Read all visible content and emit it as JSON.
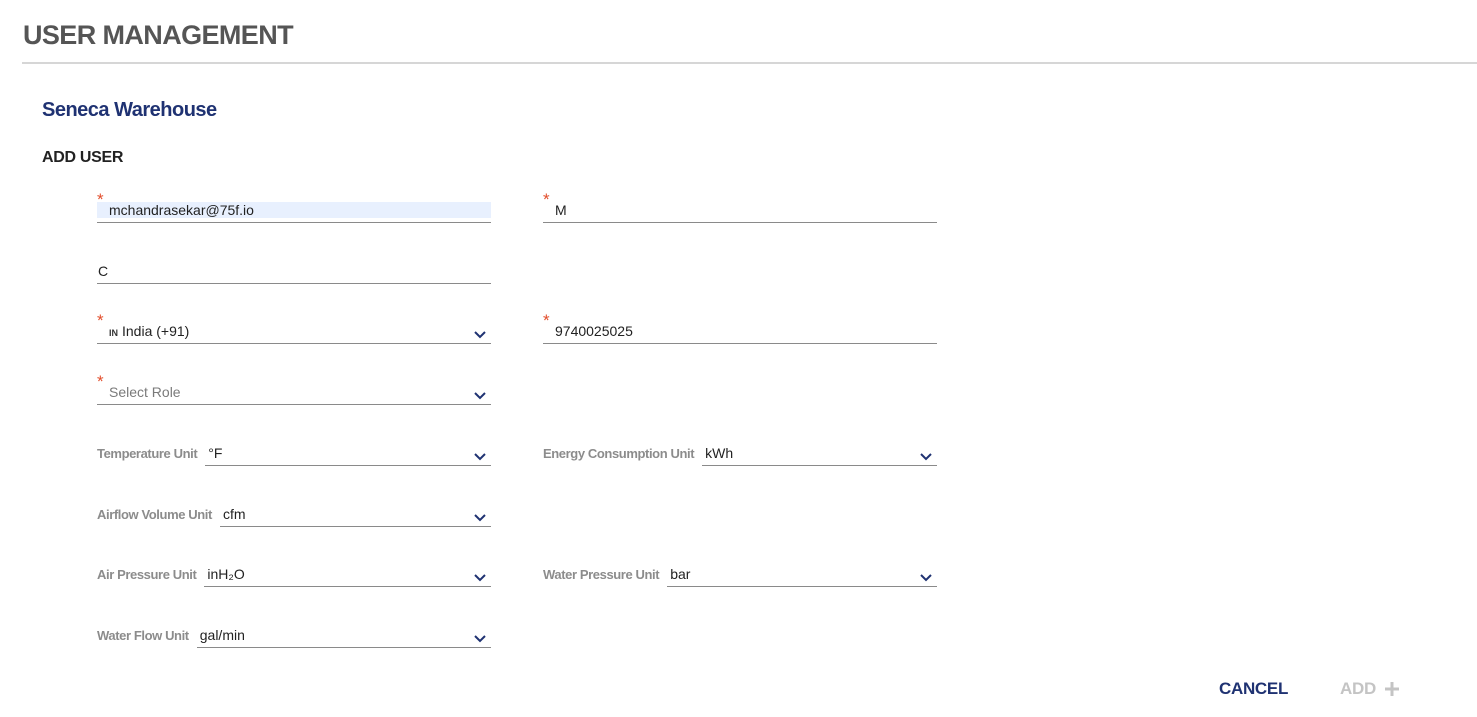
{
  "header": {
    "title": "USER MANAGEMENT"
  },
  "site": {
    "name": "Seneca Warehouse"
  },
  "form": {
    "title": "ADD USER",
    "required_mark": "*",
    "email": "mchandrasekar@75f.io",
    "first_name": "M",
    "last_name": "C",
    "country": {
      "code": "IN",
      "label": "India (+91)"
    },
    "phone": "9740025025",
    "role": {
      "placeholder": "Select Role"
    }
  },
  "units": {
    "temperature": {
      "label": "Temperature Unit",
      "value": "°F"
    },
    "energy": {
      "label": "Energy Consumption Unit",
      "value": "kWh"
    },
    "airflow": {
      "label": "Airflow Volume Unit",
      "value": "cfm"
    },
    "air_pressure": {
      "label": "Air Pressure Unit",
      "value": "inH₂O"
    },
    "water_pressure": {
      "label": "Water Pressure Unit",
      "value": "bar"
    },
    "water_flow": {
      "label": "Water Flow Unit",
      "value": "gal/min"
    }
  },
  "actions": {
    "cancel": "CANCEL",
    "add": "ADD"
  },
  "colors": {
    "brand": "#1f3272",
    "required": "#e24d2b",
    "title": "#555555",
    "disabled": "#c4c4c4"
  },
  "icons": {
    "dropdown": "chevron-down-icon",
    "add": "plus-icon"
  }
}
